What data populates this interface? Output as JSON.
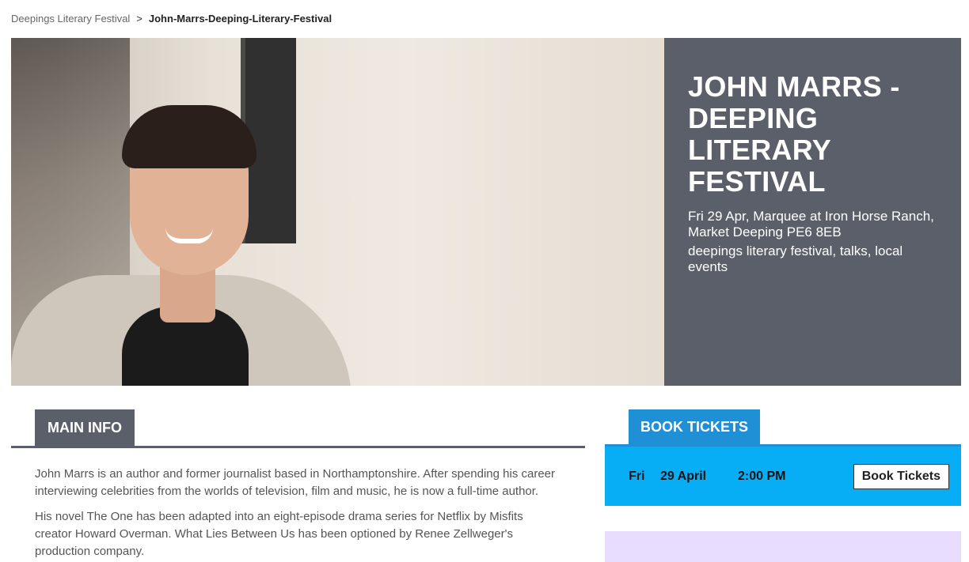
{
  "breadcrumb": {
    "parent": "Deepings Literary Festival",
    "separator": ">",
    "current": "John-Marrs-Deeping-Literary-Festival"
  },
  "hero": {
    "title_lines": [
      "JOHN MARRS -",
      "DEEPING",
      "LITERARY",
      "FESTIVAL"
    ],
    "meta": "Fri 29 Apr, Marquee at Iron Horse Ranch, Market Deeping PE6 8EB",
    "tags": "deepings literary festival, talks, local events",
    "panel_color": "#5a5f69"
  },
  "main_info": {
    "tab_label": "MAIN INFO",
    "paragraphs": [
      "John Marrs is an author and former journalist based in Northamptonshire. After spending his career interviewing celebrities from the worlds of television, film and music, he is now a full-time author.",
      "His novel The One has been adapted into an eight-episode drama series for Netflix by Misfits creator Howard Overman. What Lies Between Us has been optioned by Renee Zellweger's production company."
    ]
  },
  "book_tickets": {
    "tab_label": "BOOK TICKETS",
    "day": "Fri",
    "date": "29 April",
    "time": "2:00 PM",
    "button_label": "Book Tickets",
    "accent": "#08aef5",
    "tab_color": "#1f8fd6"
  }
}
